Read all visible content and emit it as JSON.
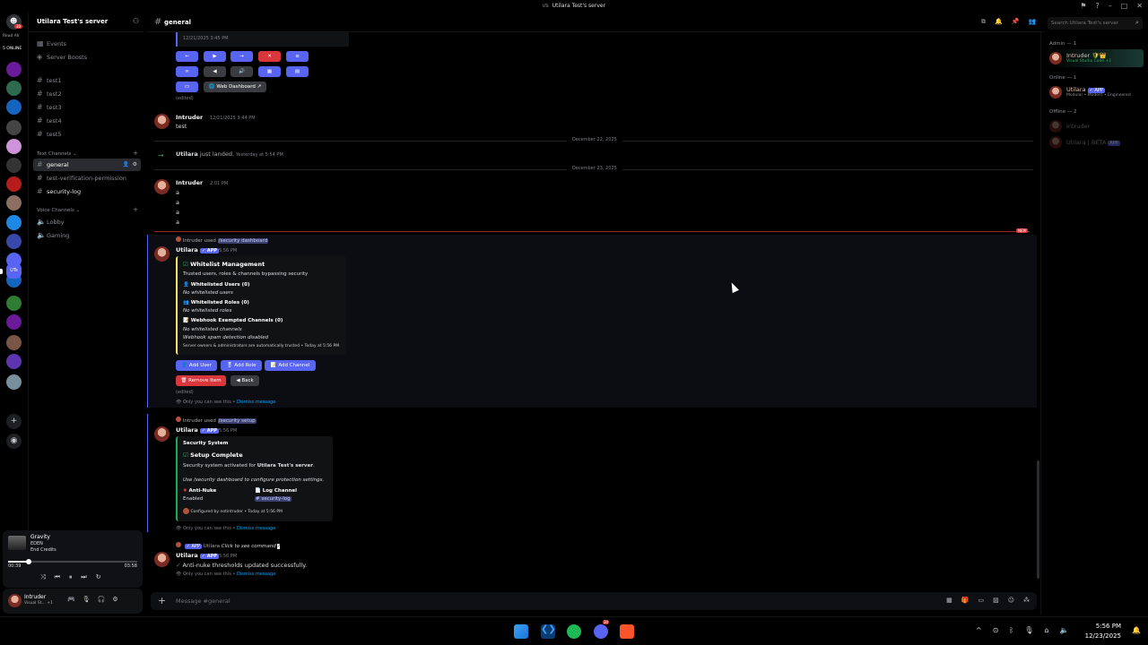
{
  "window": {
    "title": "Utilara Test's server",
    "icon_label": "UTs"
  },
  "rail": {
    "read_all": "Read All",
    "online": "5 ONLINE",
    "badge": "30",
    "servers": [
      "#6a1b9a",
      "#2d6a4f",
      "#1565c0",
      "#444",
      "#ce93d8",
      "#333",
      "#b71c1c",
      "#8d6e63",
      "#1e88e5",
      "#3949ab",
      "#5865f2",
      "#1565c0",
      "#2e7d32",
      "#6a1b9a",
      "#795548",
      "#5e35b1",
      "#78909c"
    ],
    "active_label": "UTs"
  },
  "sidebar": {
    "server_name": "Utilara Test's server",
    "top_items": [
      {
        "label": "Events",
        "icon": "calendar-icon"
      },
      {
        "label": "Server Boosts",
        "icon": "boost-icon"
      }
    ],
    "text_channels_1": [
      "test1",
      "test2",
      "test3",
      "test4",
      "test5"
    ],
    "category_text": "Text Channels",
    "channels": [
      {
        "label": "general",
        "active": true
      },
      {
        "label": "test-verification-permission",
        "active": false
      },
      {
        "label": "security-log",
        "active": false,
        "bold": true
      }
    ],
    "category_voice": "Voice Channels",
    "voice": [
      "Lobby",
      "Gaming"
    ]
  },
  "player": {
    "track": "Gravity",
    "artist": "EDEN",
    "album": "End Credits",
    "elapsed": "00:39",
    "total": "03:58",
    "progress": 0.16
  },
  "user": {
    "name": "Intruder",
    "status": "Visual St... +1"
  },
  "header": {
    "channel": "general",
    "search_placeholder": "Search Utilara Test's server"
  },
  "messages": {
    "top_embed_time": "12/21/2025 3:45 PM",
    "web_dashboard": "Web Dashboard",
    "edited": "(edited)",
    "m1": {
      "user": "Intruder",
      "time": "12/21/2025 3:44 PM",
      "text": "test"
    },
    "date1": "December 22, 2025",
    "join": {
      "user": "Utilara",
      "text": "just landed.",
      "time": "Yesterday at 5:54 PM"
    },
    "date2": "December 23, 2025",
    "m2": {
      "user": "Intruder",
      "time": "2:01 PM",
      "lines": [
        "a",
        "a",
        "a",
        "a"
      ]
    },
    "new_label": "NEW",
    "reply1": {
      "prefix": "Intruder used",
      "cmd": "/security dashboard"
    },
    "m3": {
      "user": "Utilara",
      "app": "APP",
      "time": "5:56 PM",
      "embed_title": "Whitelist Management",
      "embed_desc": "Trusted users, roles & channels bypassing security",
      "f1_title": "Whitelisted Users (0)",
      "f1_val": "No whitelisted users",
      "f2_title": "Whitelisted Roles (0)",
      "f2_val": "No whitelisted roles",
      "f3_title": "Webhook Exempted Channels (0)",
      "f3_val1": "No whitelisted channels",
      "f3_val2": "Webhook spam detection disabled",
      "footer": "Server owners & administrators are automatically trusted • Today at 5:56 PM",
      "buttons": [
        "Add User",
        "Add Role",
        "Add Channel"
      ],
      "buttons2": [
        "Remove Item",
        "Back"
      ],
      "edited": "(edited)",
      "only_you": "Only you can see this •",
      "dismiss": "Dismiss message"
    },
    "reply2": {
      "prefix": "Intruder used",
      "cmd": "/security setup"
    },
    "m4": {
      "user": "Utilara",
      "app": "APP",
      "time": "5:56 PM",
      "embed_header": "Security System",
      "embed_title": "Setup Complete",
      "desc_pre": "Security system activated for",
      "desc_bold": "Utilara Test's server",
      "desc_post": ".",
      "use_line": "Use /security dashboard to configure protection settings.",
      "f1_title": "Anti-Nuke",
      "f1_val": "Enabled",
      "f2_title": "Log Channel",
      "f2_val": "# security-log",
      "footer": "Configured by notintruder • Today at 5:56 PM",
      "only_you": "Only you can see this •",
      "dismiss": "Dismiss message"
    },
    "reply3": {
      "app": "APP",
      "name": "Utilara",
      "text": "Click to see command"
    },
    "m5": {
      "user": "Utilara",
      "app": "APP",
      "time": "5:56 PM",
      "text": "Anti-nuke thresholds updated successfully.",
      "only_you": "Only you can see this •",
      "dismiss": "Dismiss message"
    }
  },
  "composer": {
    "placeholder": "Message #general"
  },
  "members": {
    "admin": "Admin — 1",
    "admin_user": {
      "name": "Intruder",
      "sub": "Visual Studio Code +1"
    },
    "online": "Online — 1",
    "online_user": {
      "name": "Utilara",
      "app": "APP",
      "sub": "Modular • Modern • Engineered"
    },
    "offline": "Offline — 2",
    "offline_users": [
      {
        "name": "Intruder"
      },
      {
        "name": "Utilara | BETA",
        "app": "APP"
      }
    ]
  },
  "taskbar": {
    "time": "5:56 PM",
    "date": "12/23/2025",
    "discord_badge": "34"
  }
}
